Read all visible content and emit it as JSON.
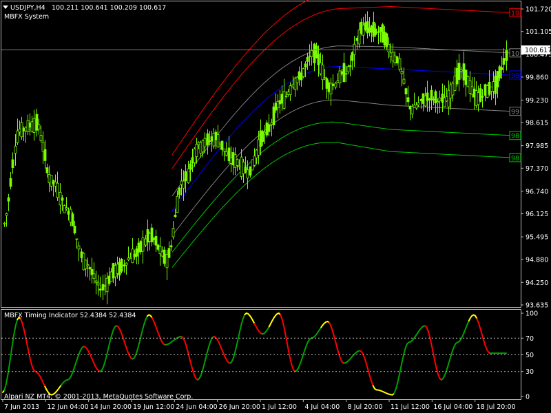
{
  "title": {
    "symbol": "USDJPY,H4",
    "ohlc": "100.211 100.641 100.209 100.617"
  },
  "indicator_main_name": "MBFX System",
  "subwindow_title": "MBFX Timing Indicator 52.4384 52.4384",
  "copyright": "Alpari NZ MT4, © 2001-2013, MetaQuotes Software Corp.",
  "current_price_label": "100.617",
  "colors": {
    "bull_candle": "#7CFC00",
    "band_red": "#FF0000",
    "band_gray": "#808080",
    "band_blue": "#0000FF",
    "band_green": "#00C800",
    "osc_green": "#00A000",
    "osc_red": "#FF0000",
    "osc_yellow": "#FFFF00",
    "grid_dots": "#C0C0C0"
  },
  "band_tags": [
    {
      "text": "10",
      "color": "#FF0000"
    },
    {
      "text": "10",
      "color": "#FF0000"
    },
    {
      "text": "10",
      "color": "#808080"
    },
    {
      "text": "99",
      "color": "#0000FF"
    },
    {
      "text": "99",
      "color": "#808080"
    },
    {
      "text": "98",
      "color": "#00C800"
    },
    {
      "text": "98",
      "color": "#00C800"
    }
  ],
  "price_axis": [
    "101.720",
    "101.105",
    "100.475",
    "99.860",
    "99.230",
    "98.615",
    "97.985",
    "97.370",
    "96.740",
    "96.125",
    "95.495",
    "94.880",
    "94.250",
    "93.635"
  ],
  "osc_axis": [
    "100",
    "70",
    "50",
    "30",
    "0"
  ],
  "time_axis": [
    "7 Jun 2013",
    "12 Jun 04:00",
    "14 Jun 20:00",
    "19 Jun 12:00",
    "24 Jun 04:00",
    "26 Jun 20:00",
    "1 Jul 12:00",
    "4 Jul 04:00",
    "8 Jul 20:00",
    "11 Jul 12:00",
    "16 Jul 04:00",
    "18 Jul 20:00"
  ],
  "chart_data": {
    "type": "line",
    "price_series": [
      {
        "x": "7 Jun 2013",
        "y": 95.8
      },
      {
        "x": "8 Jun",
        "y": 98.4
      },
      {
        "x": "10 Jun",
        "y": 98.6
      },
      {
        "x": "11 Jun",
        "y": 97.0
      },
      {
        "x": "12 Jun 04:00",
        "y": 96.2
      },
      {
        "x": "13 Jun",
        "y": 94.8
      },
      {
        "x": "14 Jun",
        "y": 94.1
      },
      {
        "x": "14 Jun 20:00",
        "y": 94.6
      },
      {
        "x": "17 Jun",
        "y": 95.0
      },
      {
        "x": "18 Jun",
        "y": 95.5
      },
      {
        "x": "19 Jun 12:00",
        "y": 94.9
      },
      {
        "x": "20 Jun",
        "y": 97.0
      },
      {
        "x": "21 Jun",
        "y": 98.0
      },
      {
        "x": "24 Jun 04:00",
        "y": 98.2
      },
      {
        "x": "25 Jun",
        "y": 97.6
      },
      {
        "x": "26 Jun 20:00",
        "y": 97.3
      },
      {
        "x": "27 Jun",
        "y": 98.3
      },
      {
        "x": "28 Jun",
        "y": 99.2
      },
      {
        "x": "1 Jul 12:00",
        "y": 99.8
      },
      {
        "x": "2 Jul",
        "y": 100.5
      },
      {
        "x": "3 Jul",
        "y": 99.6
      },
      {
        "x": "4 Jul 04:00",
        "y": 100.0
      },
      {
        "x": "5 Jul",
        "y": 101.2
      },
      {
        "x": "8 Jul 20:00",
        "y": 101.1
      },
      {
        "x": "9 Jul",
        "y": 100.4
      },
      {
        "x": "10 Jul",
        "y": 99.0
      },
      {
        "x": "11 Jul 12:00",
        "y": 99.3
      },
      {
        "x": "12 Jul",
        "y": 99.2
      },
      {
        "x": "15 Jul",
        "y": 100.0
      },
      {
        "x": "16 Jul 04:00",
        "y": 99.3
      },
      {
        "x": "17 Jul",
        "y": 99.6
      },
      {
        "x": "18 Jul 20:00",
        "y": 100.6
      }
    ],
    "osc_series": [
      {
        "x": "7 Jun 2013",
        "y": 5
      },
      {
        "x": "8 Jun",
        "y": 95
      },
      {
        "x": "10 Jun",
        "y": 30
      },
      {
        "x": "11 Jun",
        "y": 2
      },
      {
        "x": "12 Jun 04:00",
        "y": 20
      },
      {
        "x": "13 Jun",
        "y": 60
      },
      {
        "x": "14 Jun",
        "y": 30
      },
      {
        "x": "14 Jun 20:00",
        "y": 85
      },
      {
        "x": "17 Jun",
        "y": 45
      },
      {
        "x": "18 Jun",
        "y": 98
      },
      {
        "x": "19 Jun 12:00",
        "y": 62
      },
      {
        "x": "20 Jun",
        "y": 72
      },
      {
        "x": "21 Jun",
        "y": 20
      },
      {
        "x": "24 Jun 04:00",
        "y": 72
      },
      {
        "x": "25 Jun",
        "y": 40
      },
      {
        "x": "26 Jun 20:00",
        "y": 100
      },
      {
        "x": "27 Jun",
        "y": 75
      },
      {
        "x": "28 Jun",
        "y": 100
      },
      {
        "x": "1 Jul 12:00",
        "y": 30
      },
      {
        "x": "2 Jul",
        "y": 70
      },
      {
        "x": "3 Jul",
        "y": 90
      },
      {
        "x": "4 Jul 04:00",
        "y": 40
      },
      {
        "x": "5 Jul",
        "y": 55
      },
      {
        "x": "8 Jul 20:00",
        "y": 8
      },
      {
        "x": "9 Jul",
        "y": 2
      },
      {
        "x": "10 Jul",
        "y": 65
      },
      {
        "x": "11 Jul 12:00",
        "y": 85
      },
      {
        "x": "12 Jul",
        "y": 20
      },
      {
        "x": "15 Jul",
        "y": 65
      },
      {
        "x": "16 Jul 04:00",
        "y": 98
      },
      {
        "x": "17 Jul",
        "y": 52
      },
      {
        "x": "18 Jul 20:00",
        "y": 52
      }
    ],
    "ylim": [
      93.635,
      101.72
    ],
    "osc_ylim": [
      0,
      100
    ],
    "levels": [
      30,
      50,
      70
    ]
  }
}
